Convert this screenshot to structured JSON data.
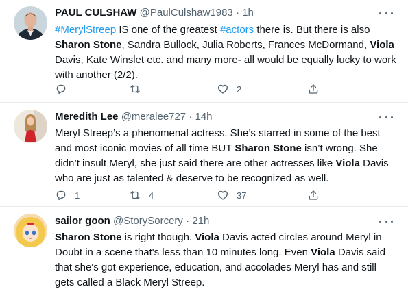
{
  "tweets": [
    {
      "name": "PAUL CULSHAW",
      "handle": "@PaulCulshaw1983",
      "time": "1h",
      "text": {
        "t1": "#MerylStreep",
        "t2": " IS one of the greatest ",
        "t3": "#actors",
        "t4": " there is. But there is also ",
        "t5": "Sharon Stone",
        "t6": ", Sandra Bullock, Julia Roberts, Frances McDormand, ",
        "t7": "Viola",
        "t8": " Davis, Kate Winslet etc. and many more- all would be equally lucky to work with another (2/2)."
      },
      "reply_count": "",
      "retweet_count": "",
      "like_count": "2"
    },
    {
      "name": "Meredith Lee",
      "handle": "@meralee727",
      "time": "14h",
      "text": {
        "t1": "Meryl Streep’s a phenomenal actress. She’s starred in some of the best and most iconic movies of all time BUT ",
        "t2": "Sharon Stone",
        "t3": " isn’t wrong. She didn’t insult Meryl, she just said there are other actresses like ",
        "t4": "Viola",
        "t5": " Davis who are just as talented & deserve to be recognized as well."
      },
      "reply_count": "1",
      "retweet_count": "4",
      "like_count": "37"
    },
    {
      "name": "sailor goon",
      "handle": "@StorySorcery",
      "time": "21h",
      "text": {
        "t1": "Sharon Stone",
        "t2": " is right though. ",
        "t3": "Viola",
        "t4": " Davis acted circles around Meryl in Doubt in a scene that's less than 10 minutes long. Even ",
        "t5": "Viola",
        "t6": " Davis said that she's got experience, education, and accolades Meryl has and still gets called a Black Meryl Streep."
      }
    }
  ],
  "icons": {
    "reply": "reply-icon",
    "retweet": "retweet-icon",
    "like": "heart-icon",
    "share": "share-icon",
    "more": "more-icon"
  },
  "colors": {
    "hashtag": "#1d9bf0",
    "text": "#0f1419",
    "secondary": "#536471",
    "divider": "#e6ecf0"
  }
}
